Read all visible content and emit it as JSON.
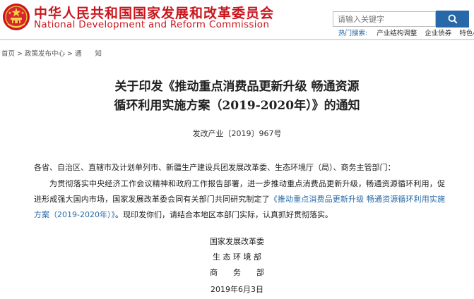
{
  "header": {
    "site_name_cn": "中华人民共和国国家发展和改革委员会",
    "site_name_en": "National Development and Reform Commission"
  },
  "search": {
    "placeholder": "请输入关键字"
  },
  "hot_search": {
    "label": "热门搜索:",
    "links": [
      "产业结构调整",
      "企业债券",
      "特色小镇"
    ]
  },
  "breadcrumb": {
    "items": [
      "首页",
      "政策发布中心",
      "通　　知"
    ],
    "separator": ">"
  },
  "document": {
    "title_line1": "关于印发《推动重点消费品更新升级 畅通资源",
    "title_line2": "循环利用实施方案（2019-2020年）》的通知",
    "number": "发改产业〔2019〕967号",
    "addressee": "各省、自治区、直辖市及计划单列市、新疆生产建设兵团发展改革委、生态环境厅（局）、商务主管部门：",
    "body_before": "为贯彻落实中央经济工作会议精神和政府工作报告部署，进一步推动重点消费品更新升级，畅通资源循环利用，促进形成强大国内市场，国家发展改革委会同有关部门共同研究制定了",
    "body_link": "《推动重点消费品更新升级 畅通资源循环利用实施方案（2019-2020年）》",
    "body_after": "。现印发你们，请结合本地区本部门实际，认真抓好贯彻落实。",
    "signature": {
      "org1": "国家发展改革委",
      "org2": "生 态 环 境 部",
      "org3": "商　　务　　部",
      "date": "2019年6月3日"
    }
  },
  "colors": {
    "brand_red": "#c9161d",
    "link_blue": "#2768a8"
  }
}
